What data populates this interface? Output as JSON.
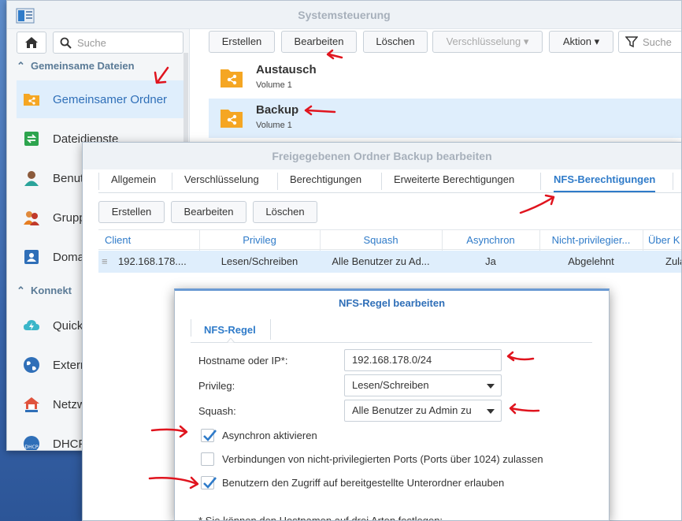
{
  "main_window": {
    "title": "Systemsteuerung",
    "sidebar": {
      "search_placeholder": "Suche",
      "sections": [
        {
          "label": "Gemeinsame Dateien"
        },
        {
          "label": "Konnekt"
        }
      ],
      "items": [
        {
          "label": "Gemeinsamer Ordner",
          "icon": "shared-folder-icon"
        },
        {
          "label": "Dateidienste",
          "icon": "file-services-icon"
        },
        {
          "label": "Benutz",
          "icon": "user-icon"
        },
        {
          "label": "Gruppe",
          "icon": "group-icon"
        },
        {
          "label": "Domain",
          "icon": "domain-icon"
        },
        {
          "label": "QuickC",
          "icon": "quickconnect-icon"
        },
        {
          "label": "Extern",
          "icon": "external-access-icon"
        },
        {
          "label": "Netzwe",
          "icon": "network-icon"
        },
        {
          "label": "DHCP-",
          "icon": "dhcp-icon"
        }
      ]
    },
    "toolbar": {
      "create": "Erstellen",
      "edit": "Bearbeiten",
      "delete": "Löschen",
      "encryption": "Verschlüsselung",
      "action": "Aktion",
      "search_placeholder": "Suche"
    },
    "folders": [
      {
        "name": "Austausch",
        "volume": "Volume 1"
      },
      {
        "name": "Backup",
        "volume": "Volume 1"
      }
    ]
  },
  "edit_dialog": {
    "title": "Freigegebenen Ordner Backup bearbeiten",
    "tabs": [
      "Allgemein",
      "Verschlüsselung",
      "Berechtigungen",
      "Erweiterte Berechtigungen",
      "NFS-Berechtigungen"
    ],
    "active_tab": "NFS-Berechtigungen",
    "buttons": {
      "create": "Erstellen",
      "edit": "Bearbeiten",
      "delete": "Löschen"
    },
    "columns": [
      "Client",
      "Privileg",
      "Squash",
      "Asynchron",
      "Nicht-privilegier...",
      "Über K"
    ],
    "rows": [
      {
        "client": "192.168.178....",
        "privilege": "Lesen/Schreiben",
        "squash": "Alle Benutzer zu Ad...",
        "async": "Ja",
        "nonpriv": "Abgelehnt",
        "cross": "Zula"
      }
    ]
  },
  "nfs_dialog": {
    "title": "NFS-Regel bearbeiten",
    "tab": "NFS-Regel",
    "hostname_label": "Hostname oder IP*:",
    "hostname_value": "192.168.178.0/24",
    "privilege_label": "Privileg:",
    "privilege_value": "Lesen/Schreiben",
    "squash_label": "Squash:",
    "squash_value": "Alle Benutzer zu Admin zu",
    "checkboxes": [
      {
        "label": "Asynchron aktivieren",
        "checked": true
      },
      {
        "label": "Verbindungen von nicht-privilegierten Ports (Ports über 1024) zulassen",
        "checked": false
      },
      {
        "label": "Benutzern den Zugriff auf bereitgestellte Unterordner erlauben",
        "checked": true
      }
    ],
    "footnote": "* Sie können den Hostnamen auf drei Arten festlegen:"
  },
  "colors": {
    "accent": "#2f7bc9",
    "selection": "#dfeefc",
    "annotation": "#e0141e",
    "folder": "#f5a623"
  }
}
